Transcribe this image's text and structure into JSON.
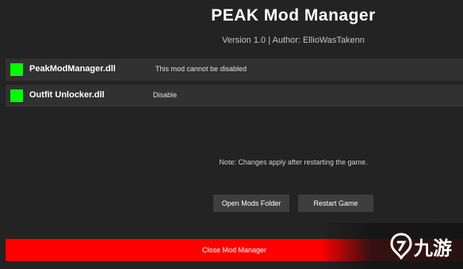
{
  "header": {
    "title": "PEAK Mod Manager",
    "subtitle": "Version 1.0 | Author: EllioWasTakenn"
  },
  "mods": [
    {
      "name": "PeakModManager.dll",
      "action": "This mod cannot be disabled",
      "status_color": "#00ff00"
    },
    {
      "name": "Outfit Unlocker.dll",
      "action": "Disable",
      "status_color": "#00ff00"
    }
  ],
  "note": "Note: Changes apply after restarting the game.",
  "buttons": {
    "open_mods_folder": "Open Mods Folder",
    "restart_game": "Restart Game"
  },
  "close_bar": {
    "label": "Close Mod Manager",
    "color": "#ff0000"
  },
  "watermark": {
    "text": "九游",
    "icon": "jiuyou-logo-icon"
  }
}
